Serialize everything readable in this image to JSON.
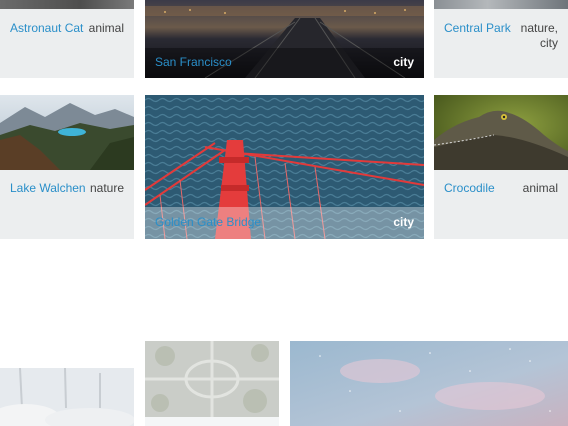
{
  "gallery": {
    "cards": [
      {
        "title": "Astronaut Cat",
        "tag": "animal"
      },
      {
        "title": "San Francisco",
        "tag": "city"
      },
      {
        "title": "Central Park",
        "tag_line1": "nature,",
        "tag_line2": "city"
      },
      {
        "title": "Lake Walchen",
        "tag": "nature"
      },
      {
        "title": "Golden Gate Bridge",
        "tag": "city"
      },
      {
        "title": "Crocodile",
        "tag": "animal"
      }
    ]
  }
}
